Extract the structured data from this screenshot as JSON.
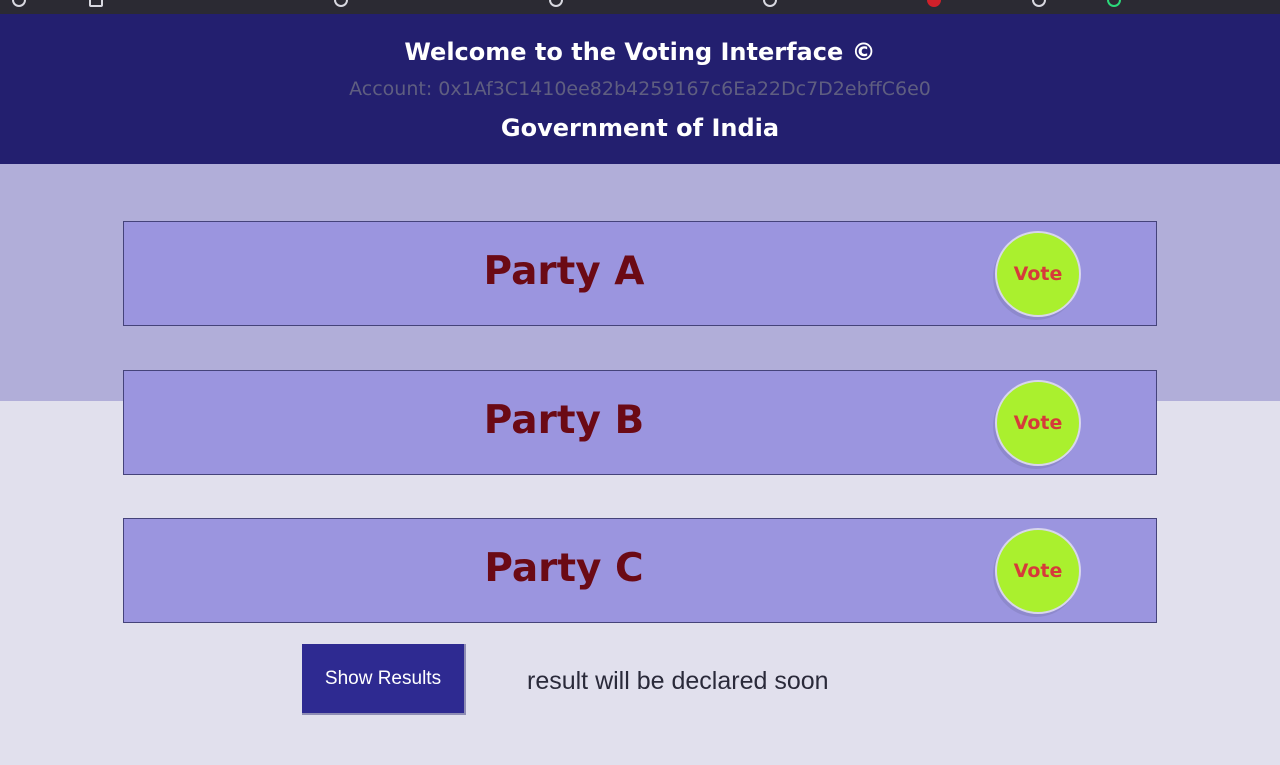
{
  "header": {
    "title": "Welcome to the Voting Interface ©",
    "account": "Account: 0x1Af3C1410ee82b4259167c6Ea22Dc7D2ebffC6e0",
    "subtitle": "Government of India"
  },
  "parties": [
    {
      "name": "Party A",
      "vote_label": "Vote"
    },
    {
      "name": "Party B",
      "vote_label": "Vote"
    },
    {
      "name": "Party C",
      "vote_label": "Vote"
    }
  ],
  "results": {
    "button_label": "Show Results",
    "message": "result will be declared soon"
  },
  "colors": {
    "header_bg": "#231f6f",
    "card_bg": "#9b95df",
    "vote_button": "#aaf02e",
    "party_text": "#6b0a15",
    "results_button": "#2e2a91"
  }
}
